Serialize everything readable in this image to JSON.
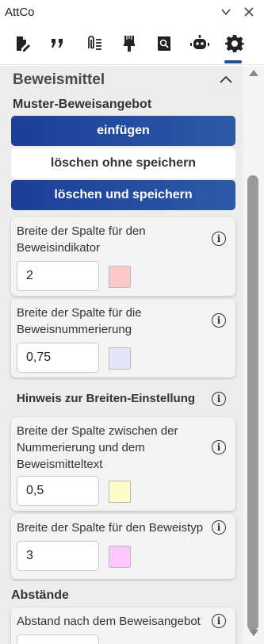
{
  "titlebar": {
    "title": "AttCo",
    "icons": [
      "chevron-down-icon",
      "close-icon"
    ]
  },
  "toolbar": {
    "icons": [
      "document-edit-icon",
      "quote-icon",
      "attachment-list-icon",
      "brush-icon",
      "book-search-icon",
      "robot-icon",
      "gear-icon"
    ],
    "active": "gear-icon",
    "accent": "#1d4f91"
  },
  "section": {
    "title": "Beweismittel",
    "muster_label": "Muster-Beweisangebot",
    "buttons": {
      "insert": "einfügen",
      "delete_nosave": "löschen ohne speichern",
      "delete_save": "löschen und speichern"
    },
    "fields": [
      {
        "label": "Breite der Spalte für den Beweisindikator",
        "value": "2",
        "swatch": "#fdc8c8"
      },
      {
        "label": "Breite der Spalte für die Beweisnummerierung",
        "value": "0,75",
        "swatch": "#e4e4fd"
      },
      {
        "label": "Breite der Spalte zwischen der Nummerierung und dem Beweismitteltext",
        "value": "0,5",
        "swatch": "#fdfdc8"
      },
      {
        "label": "Breite der Spalte für den Beweistyp",
        "value": "3",
        "swatch": "#fdc8fd"
      }
    ],
    "hint": "Hinweis zur Breiten-Einstellung",
    "abstaende_label": "Abstände",
    "abstand_label": "Abstand nach dem Beweisangebot"
  },
  "colors": {
    "primary_button": "#1b3f99"
  }
}
